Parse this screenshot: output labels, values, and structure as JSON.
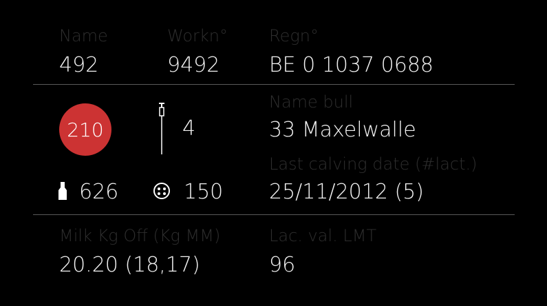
{
  "header": {
    "name_label": "Name",
    "name_value": "492",
    "workn_label": "Workn°",
    "workn_value": "9492",
    "regn_label": "Regn°",
    "regn_value": "BE 0 1037 0688"
  },
  "status": {
    "days_value": "210",
    "insemination_count": "4",
    "bull_label": "Name bull",
    "bull_value": "33 Maxelwalle",
    "calving_label": "Last calving date (#lact.)",
    "calving_value": "25/11/2012 (5)",
    "milk_total": "626",
    "cell_count": "150"
  },
  "milk": {
    "milk_label": "Milk Kg Off (Kg MM)",
    "milk_value": "20.20 (18,17)",
    "lmt_label": "Lac. val. LMT",
    "lmt_value": "96"
  },
  "colors": {
    "badge": "#cc3333",
    "label": "#2e2e2e",
    "value": "#f2f2f2",
    "divider": "#5a5a5a"
  },
  "icons": {
    "syringe": "syringe-icon",
    "bottle": "milk-bottle-icon",
    "udder": "udder-icon"
  }
}
